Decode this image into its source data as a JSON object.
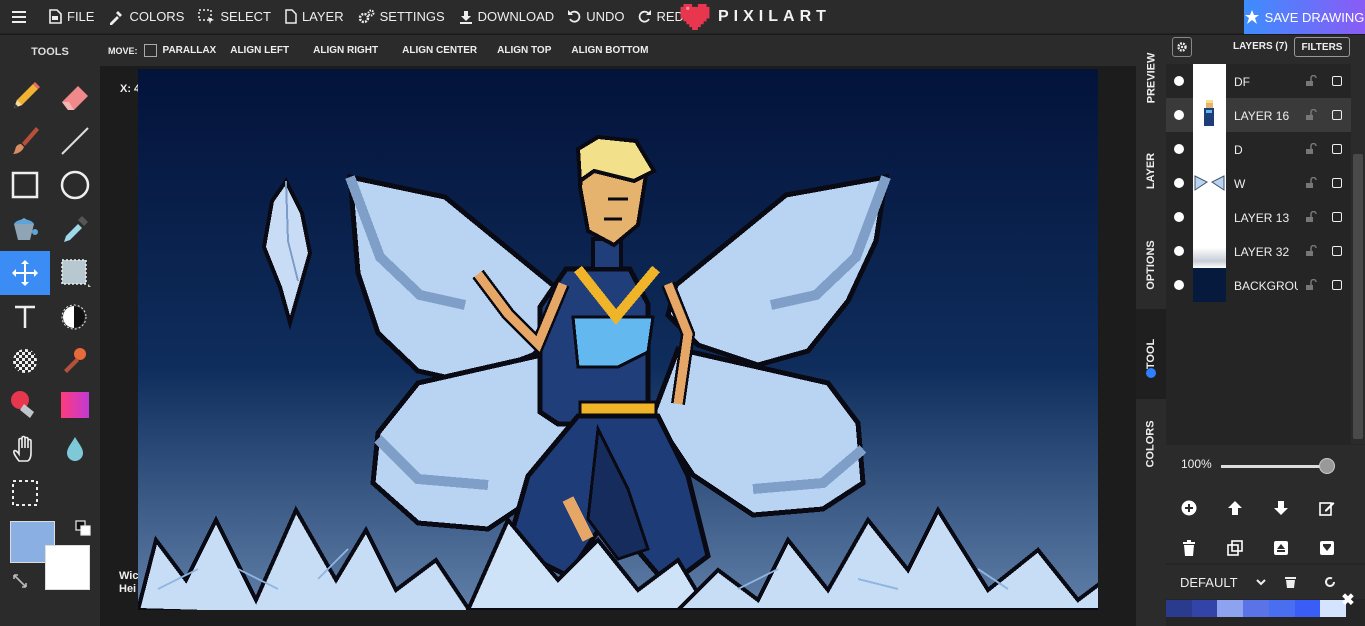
{
  "menu": {
    "file": "FILE",
    "colors": "COLORS",
    "select": "SELECT",
    "layer": "LAYER",
    "settings": "SETTINGS",
    "download": "DOWNLOAD",
    "undo": "UNDO",
    "redo": "REDO"
  },
  "brand": {
    "name": "PIXILART",
    "heart_color": "#e8364e"
  },
  "save_button": "SAVE DRAWING",
  "tools": {
    "title": "TOOLS",
    "items": [
      "pencil-icon",
      "eraser-icon",
      "brush-icon",
      "line-icon",
      "rectangle-icon",
      "circle-icon",
      "fill-bucket-icon",
      "eyedropper-icon",
      "move-icon",
      "select-shape-icon",
      "text-icon",
      "lighten-icon",
      "dither-icon",
      "stamp-icon",
      "color-replace-icon",
      "gradient-icon",
      "hand-icon",
      "blur-drop-icon",
      "marquee-icon"
    ],
    "active": "move-icon",
    "primary_color": "#8ab0e3",
    "secondary_color": "#ffffff"
  },
  "options_bar": {
    "move_label": "MOVE:",
    "parallax": "PARALLAX",
    "align_left": "ALIGN LEFT",
    "align_right": "ALIGN RIGHT",
    "align_center": "ALIGN CENTER",
    "align_top": "ALIGN TOP",
    "align_bottom": "ALIGN BOTTOM"
  },
  "canvas_info": {
    "coords": "X: 4",
    "width_label": "Wic",
    "height_label": "Hei"
  },
  "side_tabs": {
    "preview": "PREVIEW",
    "layer": "LAYER",
    "options": "OPTIONS",
    "tool": "TOOL",
    "colors": "COLORS",
    "active": "TOOL"
  },
  "layers_panel": {
    "title": "LAYERS (7)",
    "filters": "FILTERS",
    "layers": [
      {
        "name": "DF",
        "selected": false
      },
      {
        "name": "LAYER 16",
        "selected": true
      },
      {
        "name": "D",
        "selected": false
      },
      {
        "name": "W",
        "selected": false
      },
      {
        "name": "LAYER 13",
        "selected": false
      },
      {
        "name": "LAYER 32",
        "selected": false
      },
      {
        "name": "BACKGROUND",
        "selected": false
      }
    ],
    "opacity": "100%",
    "opacity_value": 1.0,
    "palette_name": "DEFAULT",
    "palette_colors": [
      "#2a3a8c",
      "#3344a8",
      "#8ea3f0",
      "#5a73e6",
      "#4a6ef0",
      "#3a5ef5",
      "#d4e4ff"
    ]
  },
  "close_label": "✖"
}
